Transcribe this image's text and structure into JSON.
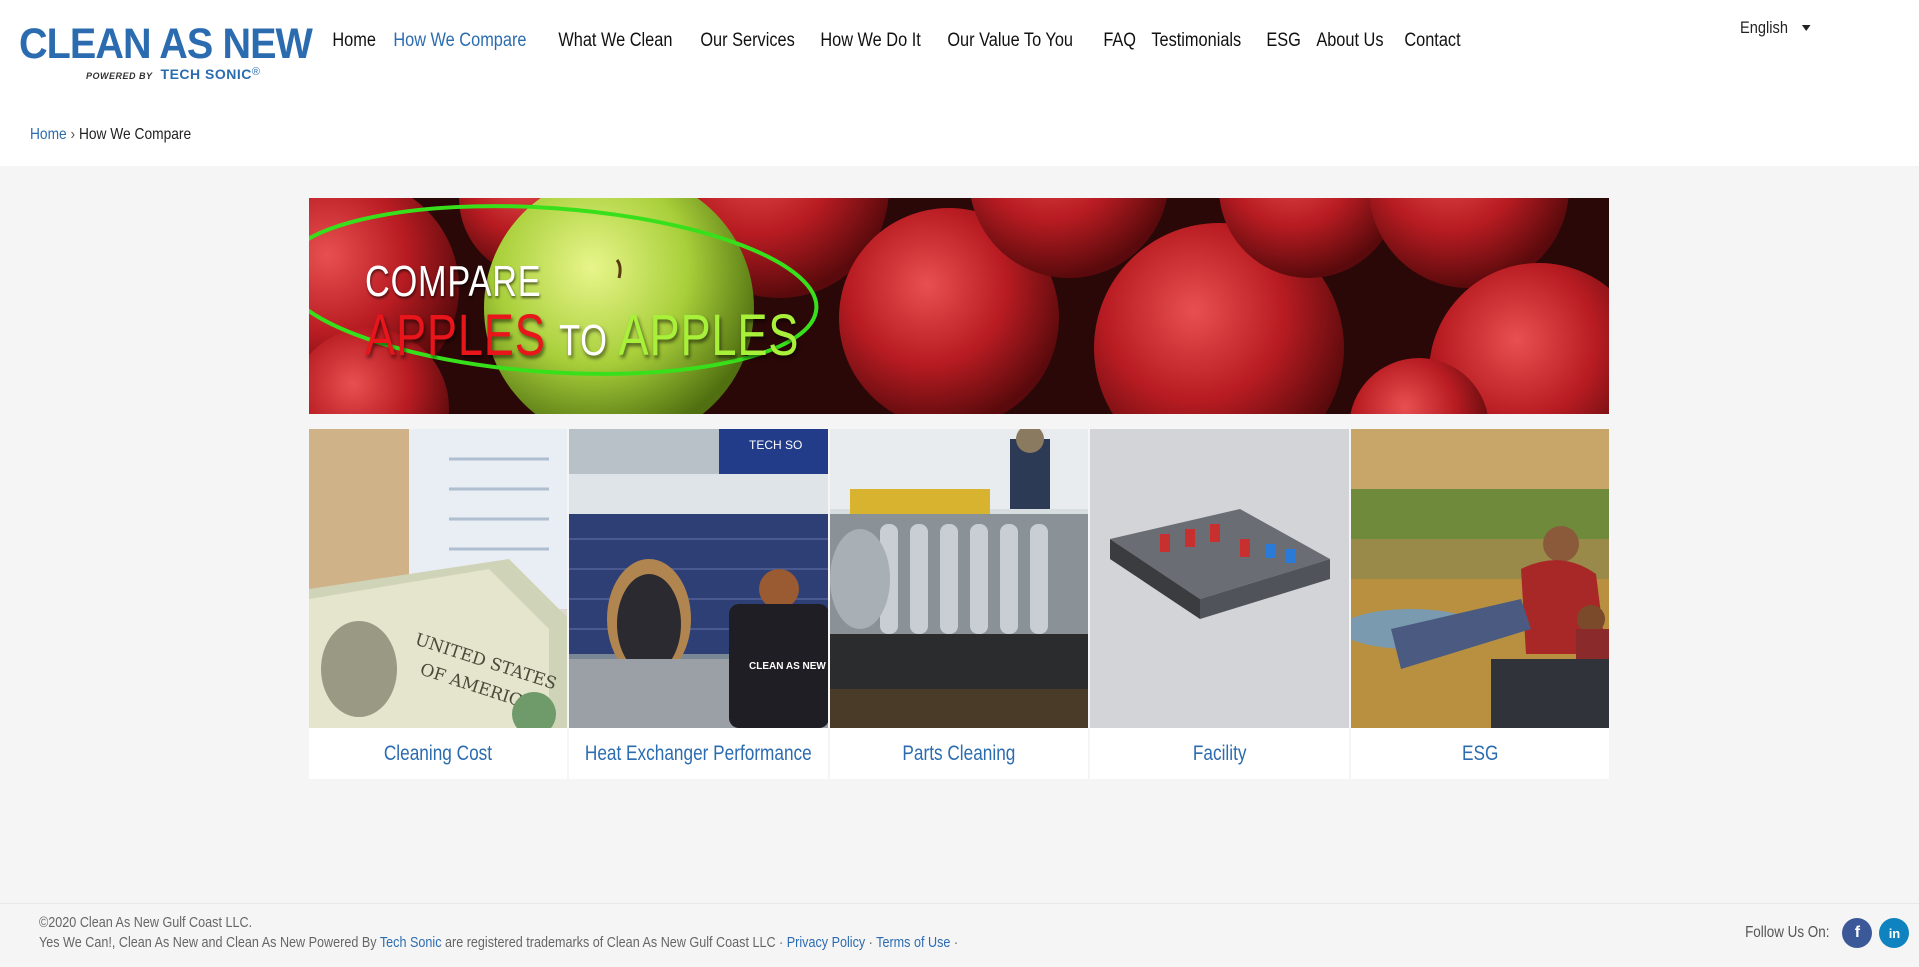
{
  "logo": {
    "main": "CLEAN AS NEW",
    "powered": "POWERED BY",
    "tech": "TECH SONIC",
    "reg": "®"
  },
  "nav": {
    "items": [
      {
        "label": "Home",
        "active": false
      },
      {
        "label": "How We Compare",
        "active": true
      },
      {
        "label": "What We Clean",
        "active": false
      },
      {
        "label": "Our Services",
        "active": false
      },
      {
        "label": "How We Do It",
        "active": false
      },
      {
        "label": "Our Value To You",
        "active": false
      },
      {
        "label": "FAQ",
        "active": false
      },
      {
        "label": "Testimonials",
        "active": false
      },
      {
        "label": "ESG",
        "active": false
      },
      {
        "label": "About Us",
        "active": false
      },
      {
        "label": "Contact",
        "active": false
      }
    ]
  },
  "language": {
    "selected": "English"
  },
  "breadcrumb": {
    "home": "Home",
    "sep": "›",
    "current": "How We Compare"
  },
  "banner": {
    "line1": "COMPARE",
    "word1": "APPLES",
    "word2": "TO",
    "word3": "APPLES"
  },
  "tiles": [
    {
      "label": "Cleaning Cost",
      "icon": "money-image"
    },
    {
      "label": "Heat Exchanger Performance",
      "icon": "heat-exchanger-image"
    },
    {
      "label": "Parts Cleaning",
      "icon": "parts-image"
    },
    {
      "label": "Facility",
      "icon": "facility-image"
    },
    {
      "label": "ESG",
      "icon": "esg-image"
    }
  ],
  "footer": {
    "copyright": "©2020 Clean As New Gulf Coast LLC.",
    "trademark_prefix": "Yes We Can!, Clean As New and Clean As New Powered By",
    "tech_link": "Tech Sonic",
    "trademark_suffix": "are registered trademarks of Clean As New Gulf Coast LLC ·",
    "privacy": "Privacy Policy",
    "dot": "·",
    "terms": "Terms of Use",
    "dot2": "·",
    "follow": "Follow Us On:",
    "facebook": "f",
    "linkedin": "in"
  },
  "colors": {
    "brand": "#2b6cb0",
    "red": "#e8151b",
    "green": "#a8f03a",
    "facebook": "#3b5998",
    "linkedin": "#0e83bf"
  }
}
